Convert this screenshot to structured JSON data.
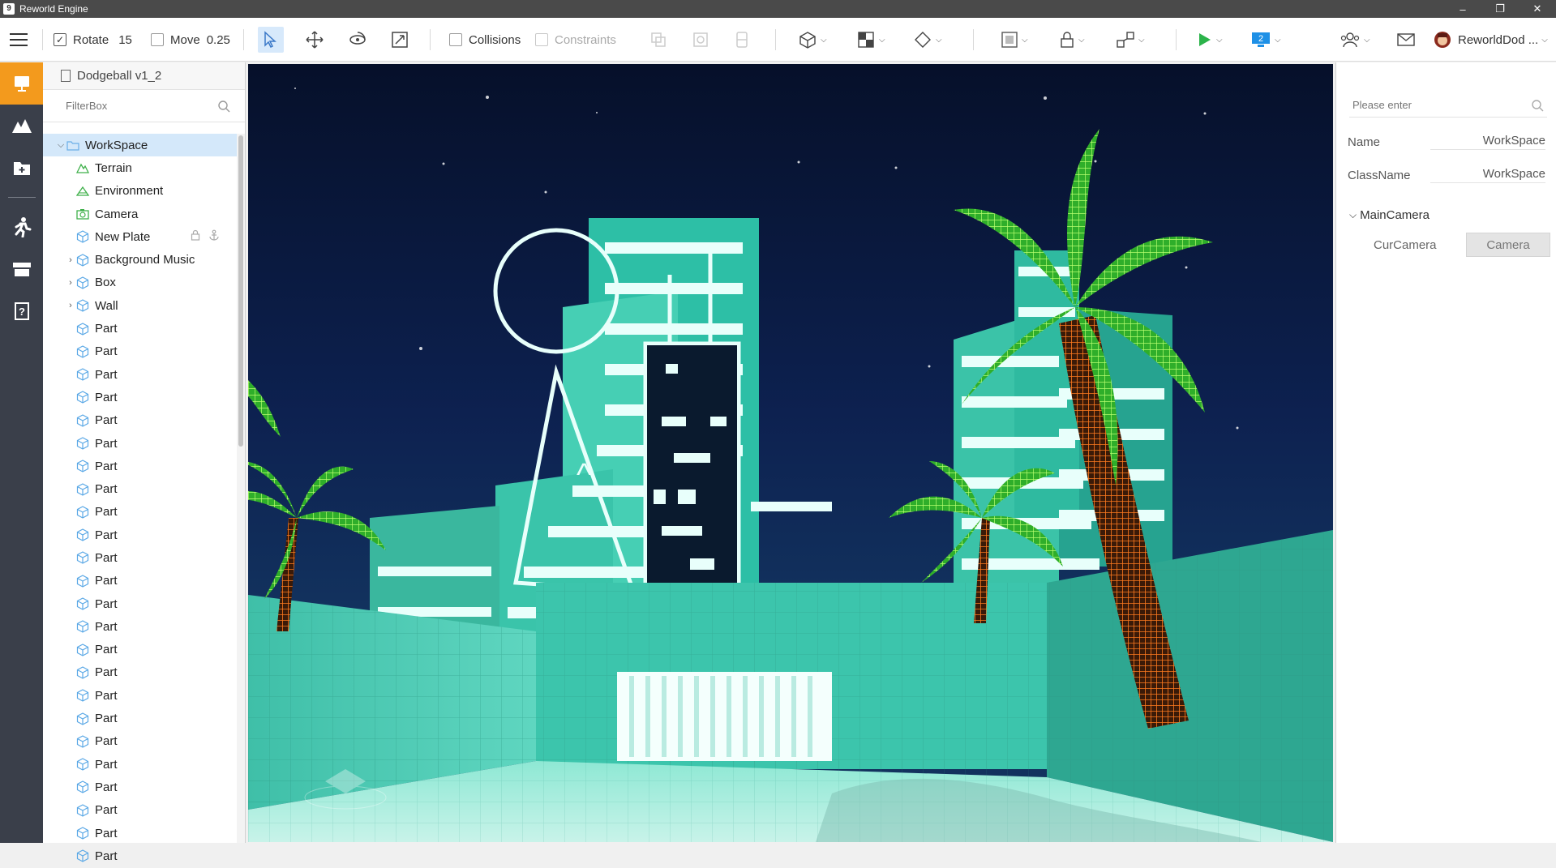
{
  "window": {
    "title": "Reworld Engine",
    "controls": [
      "–",
      "❐",
      "✕"
    ]
  },
  "toolbar": {
    "rotate": {
      "label": "Rotate",
      "checked": true,
      "value": "15"
    },
    "move": {
      "label": "Move",
      "checked": false,
      "value": "0.25"
    },
    "collisions": {
      "label": "Collisions",
      "checked": false
    },
    "constraints": {
      "label": "Constraints",
      "checked": false,
      "disabled": true
    },
    "user_name": "ReworldDod ...",
    "accent": "#1a9e3b",
    "play_color": "#2bb34a",
    "device_badge": "2"
  },
  "rail": {
    "items": [
      "workspace",
      "terrain",
      "add-asset",
      "character",
      "store",
      "help"
    ],
    "active_color": "#f39a1d"
  },
  "explorer": {
    "doc_title": "Dodgeball v1_2",
    "filter_placeholder": "FilterBox",
    "root": "WorkSpace",
    "items": [
      {
        "label": "Terrain",
        "icon": "terrain-icon",
        "expandable": false
      },
      {
        "label": "Environment",
        "icon": "environment-icon",
        "expandable": false
      },
      {
        "label": "Camera",
        "icon": "camera-icon",
        "expandable": false
      },
      {
        "label": "New Plate",
        "icon": "cube-icon",
        "expandable": false,
        "actions": true
      },
      {
        "label": "Background Music",
        "icon": "cube-icon",
        "expandable": true
      },
      {
        "label": "Box",
        "icon": "cube-icon",
        "expandable": true
      },
      {
        "label": "Wall",
        "icon": "cube-icon",
        "expandable": true
      },
      {
        "label": "Part",
        "icon": "cube-icon",
        "expandable": false
      },
      {
        "label": "Part",
        "icon": "cube-icon",
        "expandable": false
      },
      {
        "label": "Part",
        "icon": "cube-icon",
        "expandable": false
      },
      {
        "label": "Part",
        "icon": "cube-icon",
        "expandable": false
      },
      {
        "label": "Part",
        "icon": "cube-icon",
        "expandable": false
      },
      {
        "label": "Part",
        "icon": "cube-icon",
        "expandable": false
      },
      {
        "label": "Part",
        "icon": "cube-icon",
        "expandable": false
      },
      {
        "label": "Part",
        "icon": "cube-icon",
        "expandable": false
      },
      {
        "label": "Part",
        "icon": "cube-icon",
        "expandable": false
      },
      {
        "label": "Part",
        "icon": "cube-icon",
        "expandable": false
      },
      {
        "label": "Part",
        "icon": "cube-icon",
        "expandable": false
      },
      {
        "label": "Part",
        "icon": "cube-icon",
        "expandable": false
      },
      {
        "label": "Part",
        "icon": "cube-icon",
        "expandable": false
      },
      {
        "label": "Part",
        "icon": "cube-icon",
        "expandable": false
      },
      {
        "label": "Part",
        "icon": "cube-icon",
        "expandable": false
      },
      {
        "label": "Part",
        "icon": "cube-icon",
        "expandable": false
      },
      {
        "label": "Part",
        "icon": "cube-icon",
        "expandable": false
      },
      {
        "label": "Part",
        "icon": "cube-icon",
        "expandable": false
      },
      {
        "label": "Part",
        "icon": "cube-icon",
        "expandable": false
      },
      {
        "label": "Part",
        "icon": "cube-icon",
        "expandable": false
      },
      {
        "label": "Part",
        "icon": "cube-icon",
        "expandable": false
      },
      {
        "label": "Part",
        "icon": "cube-icon",
        "expandable": false
      },
      {
        "label": "Part",
        "icon": "cube-icon",
        "expandable": false
      },
      {
        "label": "Part",
        "icon": "cube-icon",
        "expandable": false
      }
    ]
  },
  "properties": {
    "search_placeholder": "Please enter",
    "rows": [
      {
        "key": "Name",
        "value": "WorkSpace"
      },
      {
        "key": "ClassName",
        "value": "WorkSpace"
      }
    ],
    "section": "MainCamera",
    "cur_camera_label": "CurCamera",
    "cur_camera_value": "Camera"
  },
  "scene": {
    "sky_color": "#08142e",
    "neon_color": "#5fe3cc",
    "palm_color": "#3fc93a",
    "trunk_color": "#e06a1d"
  }
}
